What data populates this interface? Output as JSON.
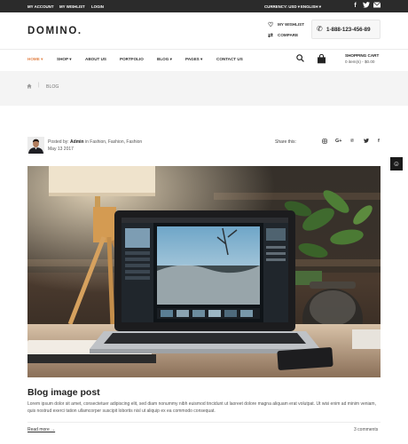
{
  "topbar": {
    "my_account": "MY ACCOUNT",
    "my_wishlist": "MY WISHLIST",
    "login": "LOGIN",
    "currency": "CURRENCY: USD",
    "language": "ENGLISH",
    "social": [
      "facebook-icon",
      "twitter-icon",
      "email-icon"
    ]
  },
  "header": {
    "logo": "DOMINO.",
    "wishlist": "MY WISHLIST",
    "compare": "COMPARE",
    "phone": "1-888-123-456-89"
  },
  "nav": {
    "items": [
      "HOME",
      "SHOP",
      "ABOUT US",
      "PORTFOLIO",
      "BLOG",
      "PAGES",
      "CONTACT US"
    ],
    "cart_title": "SHOPPING CART",
    "cart_summary": "0 item(s) - $0.00"
  },
  "breadcrumb": {
    "current": "BLOG"
  },
  "post": {
    "posted_by_prefix": "Posted by:",
    "author": "Admin",
    "categories": "in Fashion, Fashion, Fashion",
    "date": "May 13 2017",
    "share_label": "Share this:",
    "share_icons": [
      "instagram-icon",
      "google-plus-icon",
      "pinterest-icon",
      "twitter-icon",
      "facebook-icon"
    ],
    "title": "Blog image post",
    "excerpt": "Lorem ipsum dolor sit amet, consectetuer adipiscing elit, sed diam nonummy nibh euismod tincidunt ut laoreet dolore magna aliquam erat volutpat. Ut wisi enim ad minim veniam, quis nostrud exerci tation ullamcorper suscipit lobortis nisl ut aliquip ex ea commodo consequat.",
    "read_more": "Read more →",
    "comments": "3 comments"
  },
  "colors": {
    "topbar": "#2b2b2b",
    "accent": "#e2844a",
    "band": "#f4f4f4"
  }
}
